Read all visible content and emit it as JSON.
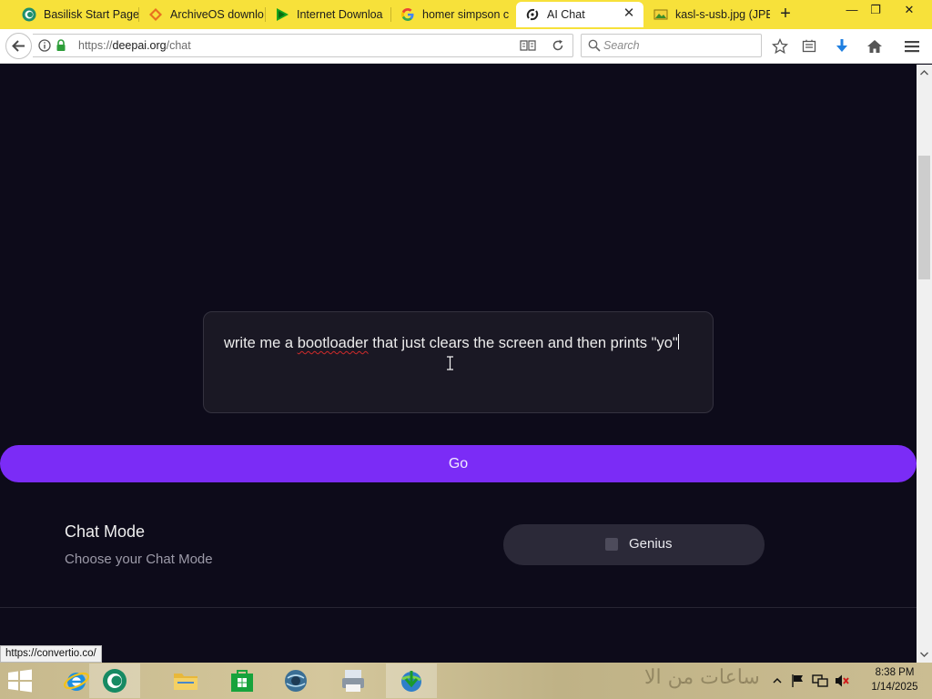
{
  "tabs": [
    {
      "label": "Basilisk Start Page",
      "icon": "basilisk-icon"
    },
    {
      "label": "ArchiveOS downlo",
      "icon": "archiveos-icon"
    },
    {
      "label": "Internet Downloa",
      "icon": "play-icon"
    },
    {
      "label": "homer simpson c",
      "icon": "google-icon"
    },
    {
      "label": "AI Chat",
      "icon": "deepai-icon",
      "active": true
    },
    {
      "label": "kasl-s-usb.jpg (JPE",
      "icon": "image-icon"
    }
  ],
  "tab_close_symbol": "✕",
  "new_tab_symbol": "+",
  "window": {
    "minimize": "—",
    "restore": "❐",
    "close": "✕"
  },
  "navbar": {
    "url_prefix": "https://",
    "url_domain": "deepai.org",
    "url_path": "/chat",
    "search_placeholder": "Search"
  },
  "chat": {
    "prompt_before": "write me a ",
    "prompt_misspelled": "bootloader",
    "prompt_after": " that just clears the screen and then prints \"yo\"",
    "go_label": "Go",
    "mode_title": "Chat Mode",
    "mode_subtitle": "Choose your Chat Mode",
    "genius_label": "Genius"
  },
  "status_link": "https://convertio.co/",
  "taskbar": {
    "clock_time": "8:38 PM",
    "clock_date": "1/14/2025",
    "wallpaper_text": "ساعات من الا"
  },
  "colors": {
    "tabstrip": "#f7e13a",
    "page_bg": "#0d0b1a",
    "go_button": "#7b2cf6",
    "prompt_box": "#1a1824"
  }
}
